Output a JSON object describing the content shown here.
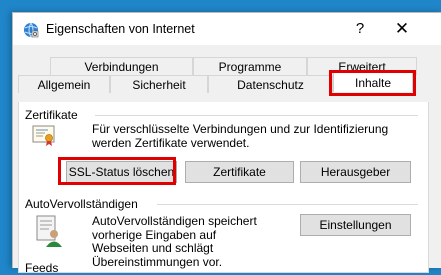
{
  "window": {
    "title": "Eigenschaften von Internet",
    "help_label": "?",
    "close_label": "✕"
  },
  "tabs": {
    "row1": [
      "Verbindungen",
      "Programme",
      "Erweitert"
    ],
    "row2": [
      "Allgemein",
      "Sicherheit",
      "Datenschutz",
      "Inhalte"
    ],
    "active": "Inhalte"
  },
  "certificates": {
    "group_label": "Zertifikate",
    "description": "Für verschlüsselte Verbindungen und zur Identifizierung werden Zertifikate verwendet.",
    "buttons": [
      "SSL-Status löschen",
      "Zertifikate",
      "Herausgeber"
    ]
  },
  "autocomplete": {
    "group_label": "AutoVervollständigen",
    "description": "AutoVervollständigen speichert vorherige Eingaben auf Webseiten und schlägt Übereinstimmungen vor.",
    "settings_button": "Einstellungen"
  },
  "feeds": {
    "group_label": "Feeds"
  },
  "colors": {
    "highlight": "#e00000",
    "desktop": "#1f86c9"
  }
}
